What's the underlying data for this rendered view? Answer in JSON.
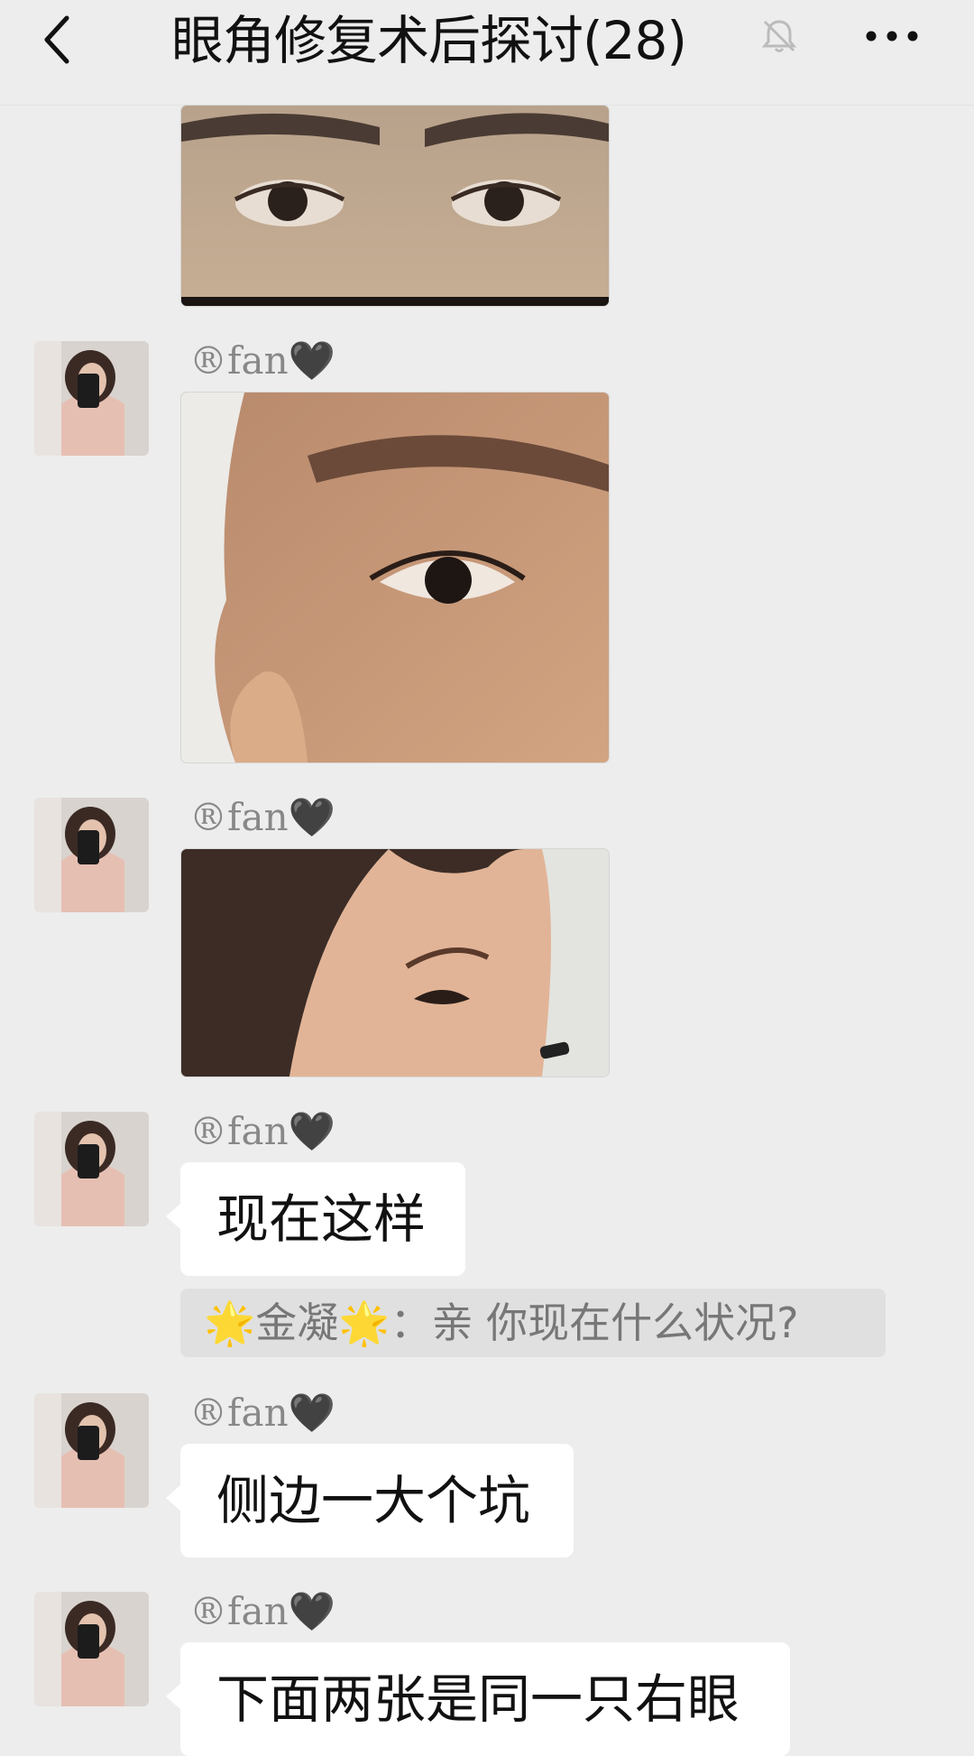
{
  "header": {
    "title": "眼角修复术后探讨(28)",
    "back_icon": "chevron-left-icon",
    "mute_icon": "bell-off-icon",
    "more_icon": "more-dots-icon"
  },
  "messages": [
    {
      "type": "image",
      "sender": "",
      "content": "cropped-eye-photo"
    },
    {
      "type": "image",
      "sender": "®fan🖤",
      "content": "side-eye-photo"
    },
    {
      "type": "image",
      "sender": "®fan🖤",
      "content": "profile-photo"
    },
    {
      "type": "text",
      "sender": "®fan🖤",
      "text": "现在这样"
    },
    {
      "type": "quote",
      "quote_sender": "🌟金凝🌟",
      "quote_sep": "：",
      "quote_text": "亲 你现在什么状况?"
    },
    {
      "type": "text",
      "sender": "®fan🖤",
      "text": "侧边一大个坑"
    },
    {
      "type": "text",
      "sender": "®fan🖤",
      "text": "下面两张是同一只右眼"
    }
  ],
  "colors": {
    "background": "#ededed",
    "bubble": "#ffffff",
    "quote_bg": "#e0e0e0",
    "name_text": "#888888"
  }
}
